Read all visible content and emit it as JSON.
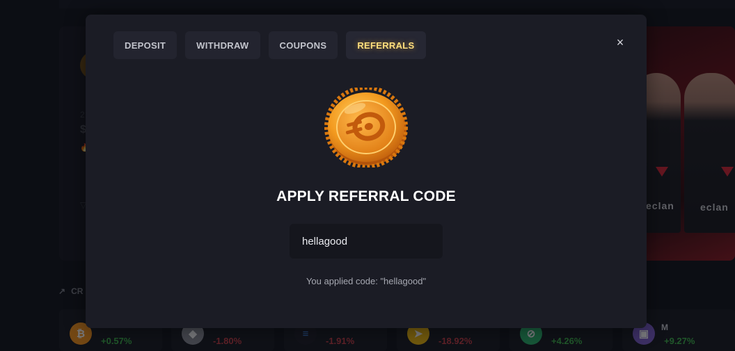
{
  "background": {
    "hero_partial_number": "2",
    "hero_partial_dollar": "$",
    "promo_logo_text": "eclan",
    "section_title_partial": "CR",
    "tickers": [
      {
        "icon": "bitcoin-icon",
        "symbol": "₿",
        "name": "",
        "change": "+0.57%",
        "direction": "up",
        "color": "#f7931a"
      },
      {
        "icon": "ethereum-icon",
        "symbol": "◆",
        "name": "",
        "change": "-1.80%",
        "direction": "down",
        "color": "#8a8d96"
      },
      {
        "icon": "solana-icon",
        "symbol": "≡",
        "name": "",
        "change": "-1.91%",
        "direction": "down",
        "color": "#1b1c25"
      },
      {
        "icon": "bnb-icon",
        "symbol": "➤",
        "name": "",
        "change": "-18.92%",
        "direction": "down",
        "color": "#f0b90b"
      },
      {
        "icon": "green-coin-icon",
        "symbol": "⊘",
        "name": "",
        "change": "+4.26%",
        "direction": "up",
        "color": "#29b36c"
      },
      {
        "icon": "purple-coin-icon",
        "symbol": "▣",
        "name": "M",
        "change": "+9.27%",
        "direction": "up",
        "color": "#7b5cc9"
      }
    ]
  },
  "modal": {
    "tabs": [
      {
        "label": "DEPOSIT",
        "active": false
      },
      {
        "label": "WITHDRAW",
        "active": false
      },
      {
        "label": "COUPONS",
        "active": false
      },
      {
        "label": "REFERRALS",
        "active": true
      }
    ],
    "close_symbol": "×",
    "heading": "APPLY REFERRAL CODE",
    "input_value": "hellagood",
    "applied_message": "You applied code: \"hellagood\""
  },
  "colors": {
    "accent_gold": "#ffdf7d",
    "coin_orange": "#f39a1f",
    "modal_bg": "#1b1c25",
    "up": "#3cb44a",
    "down": "#c73c45"
  }
}
